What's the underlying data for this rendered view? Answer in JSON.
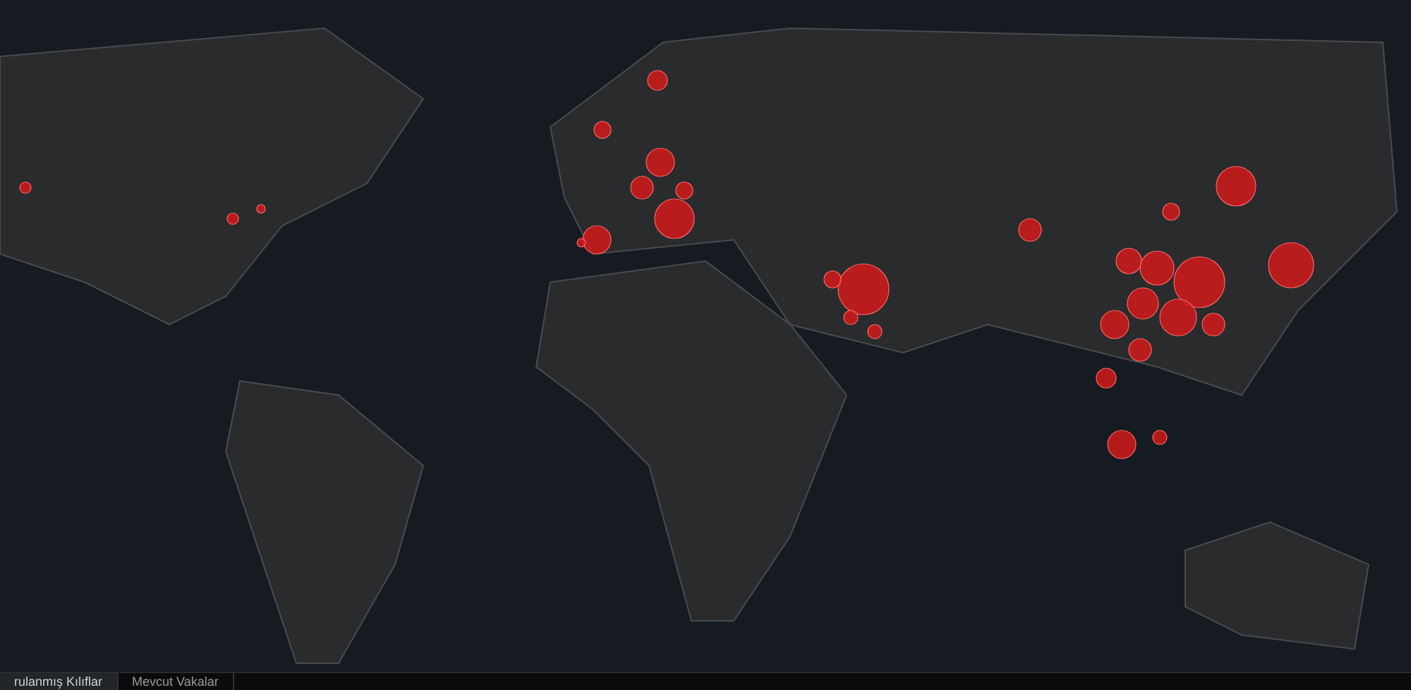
{
  "tabs": [
    {
      "label": "rulanmış Kılıflar",
      "selected": true
    },
    {
      "label": "Mevcut Vakalar",
      "selected": false
    }
  ]
}
